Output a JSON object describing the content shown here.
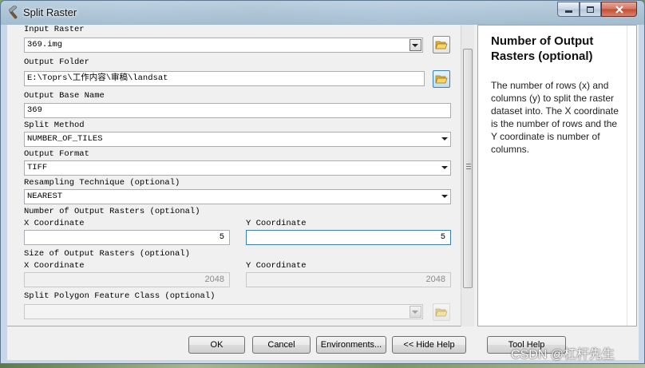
{
  "window": {
    "title": "Split Raster"
  },
  "fields": {
    "input_raster": {
      "label": "Input Raster",
      "value": "369.img"
    },
    "output_folder": {
      "label": "Output Folder",
      "value": "E:\\Toprs\\工作内容\\审稿\\landsat"
    },
    "output_base_name": {
      "label": "Output Base Name",
      "value": "369"
    },
    "split_method": {
      "label": "Split Method",
      "value": "NUMBER_OF_TILES"
    },
    "output_format": {
      "label": "Output Format",
      "value": "TIFF"
    },
    "resampling": {
      "label": "Resampling Technique (optional)",
      "value": "NEAREST"
    },
    "num_rasters": {
      "label": "Number of Output Rasters (optional)",
      "x_label": "X Coordinate",
      "x_value": "5",
      "y_label": "Y Coordinate",
      "y_value": "5"
    },
    "size_rasters": {
      "label": "Size of Output Rasters (optional)",
      "x_label": "X Coordinate",
      "x_value": "2048",
      "y_label": "Y Coordinate",
      "y_value": "2048"
    },
    "split_polygon": {
      "label": "Split Polygon Feature Class (optional)",
      "value": ""
    }
  },
  "help": {
    "title": "Number of Output Rasters (optional)",
    "body": "The number of rows (x) and columns (y) to split the raster dataset into. The X coordinate is the number of rows and the Y coordinate is number of columns."
  },
  "buttons": {
    "ok": "OK",
    "cancel": "Cancel",
    "environments": "Environments...",
    "hide_help": "<< Hide Help",
    "tool_help": "Tool Help"
  },
  "watermark": "CSDN @杠杆先生",
  "icons": {
    "title": "hammer-icon",
    "folder": "open-folder-icon"
  }
}
